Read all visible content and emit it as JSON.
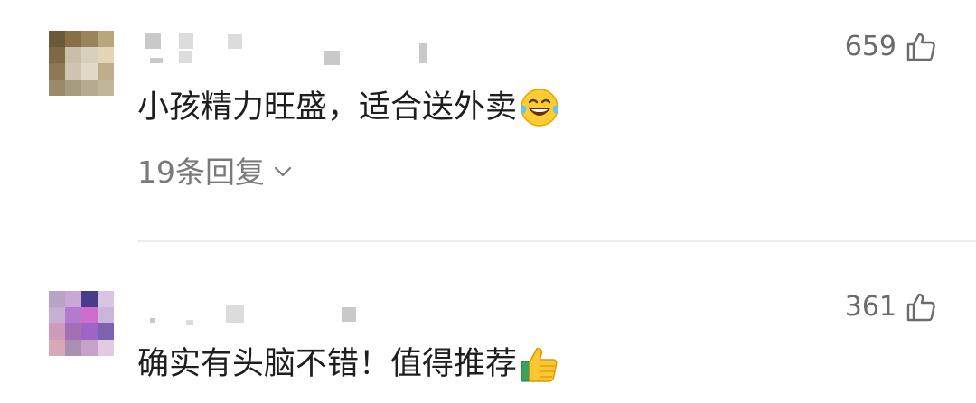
{
  "comments": [
    {
      "likes": "659",
      "text": "小孩精力旺盛，适合送外卖",
      "emoji": "laughing-tears-icon",
      "replies_label": "19条回复"
    },
    {
      "likes": "361",
      "text": "确实有头脑不错！值得推荐",
      "emoji": "thumbs-up-emoji-icon"
    }
  ],
  "colors": {
    "like_text": "#6b6b6b",
    "reply_text": "#7a7a7a",
    "comment_text": "#1e1e1e",
    "divider": "#ededed"
  }
}
